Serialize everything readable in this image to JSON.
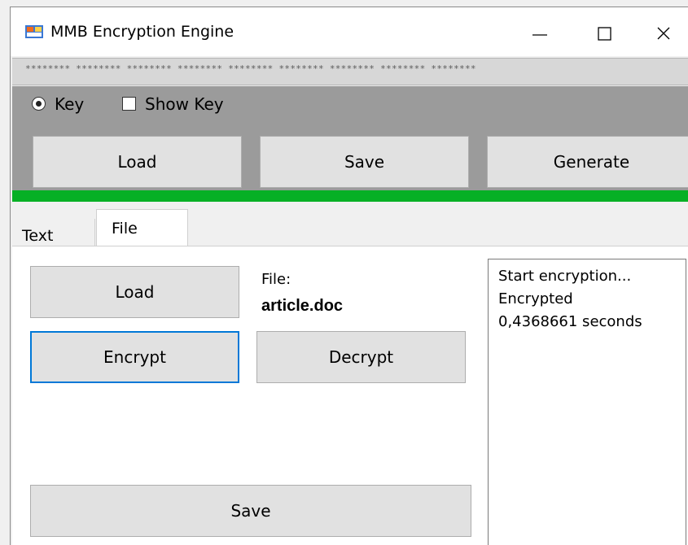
{
  "window": {
    "title": "MMB Encryption Engine"
  },
  "key_bar": {
    "masked_key": "******** ******** ******** ******** ******** ******** ******** ******** ********"
  },
  "key_panel": {
    "key_radio_label": "Key",
    "show_key_label": "Show Key",
    "show_key_checked": false,
    "buttons": {
      "load": "Load",
      "save": "Save",
      "generate": "Generate"
    }
  },
  "progress": {
    "value_fraction": 1.0,
    "color": "#06b025"
  },
  "tabs": [
    {
      "label": "Text",
      "selected": false
    },
    {
      "label": "File",
      "selected": true
    }
  ],
  "file_tab": {
    "load_label": "Load",
    "encrypt_label": "Encrypt",
    "decrypt_label": "Decrypt",
    "save_label": "Save",
    "file_label": "File:",
    "file_name": "article.doc",
    "log_lines": [
      "Start encryption...",
      "Encrypted",
      "0,4368661 seconds"
    ]
  }
}
